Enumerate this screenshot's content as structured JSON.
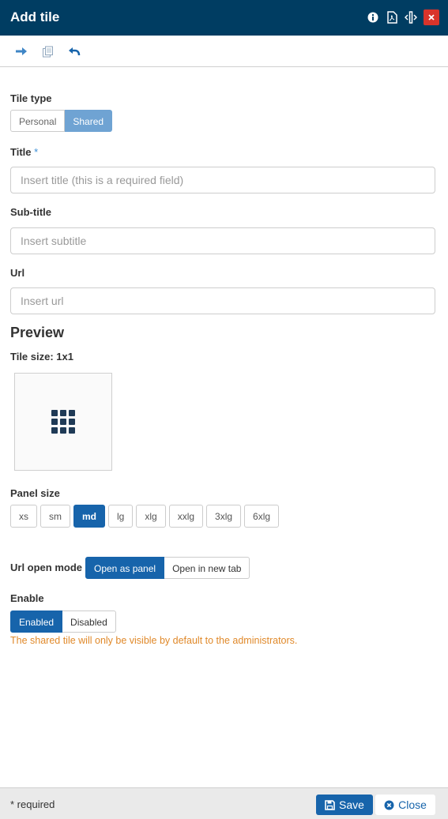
{
  "window": {
    "title": "Add tile",
    "icons": [
      "info-icon",
      "pdf-icon",
      "expand-width-icon",
      "close-icon"
    ]
  },
  "toolbar": {
    "icons": [
      "arrow-right-icon",
      "copy-icon",
      "undo-icon"
    ]
  },
  "form": {
    "tile_type": {
      "label": "Tile type",
      "options": [
        "Personal",
        "Shared"
      ],
      "selected": "Shared"
    },
    "title": {
      "label": "Title",
      "required_mark": "*",
      "value": "",
      "placeholder": "Insert title (this is a required field)"
    },
    "subtitle": {
      "label": "Sub-title",
      "value": "",
      "placeholder": "Insert subtitle"
    },
    "url": {
      "label": "Url",
      "value": "",
      "placeholder": "Insert url"
    }
  },
  "preview": {
    "heading": "Preview",
    "tile_size_label": "Tile size: 1x1",
    "tile_icon": "grid-icon"
  },
  "panel_size": {
    "label": "Panel size",
    "options": [
      "xs",
      "sm",
      "md",
      "lg",
      "xlg",
      "xxlg",
      "3xlg",
      "6xlg"
    ],
    "selected": "md"
  },
  "url_open_mode": {
    "label": "Url open mode",
    "options": [
      "Open as panel",
      "Open in new tab"
    ],
    "selected": "Open as panel"
  },
  "enable": {
    "label": "Enable",
    "options": [
      "Enabled",
      "Disabled"
    ],
    "selected": "Enabled",
    "note": "The shared tile will only be visible by default to the administrators."
  },
  "footer": {
    "required_note": "* required",
    "save_label": "Save",
    "close_label": "Close"
  },
  "colors": {
    "header": "#003d62",
    "primary": "#1764ab",
    "selected_light": "#6fa3d3",
    "note": "#e0892a",
    "close_button": "#d9342b"
  }
}
